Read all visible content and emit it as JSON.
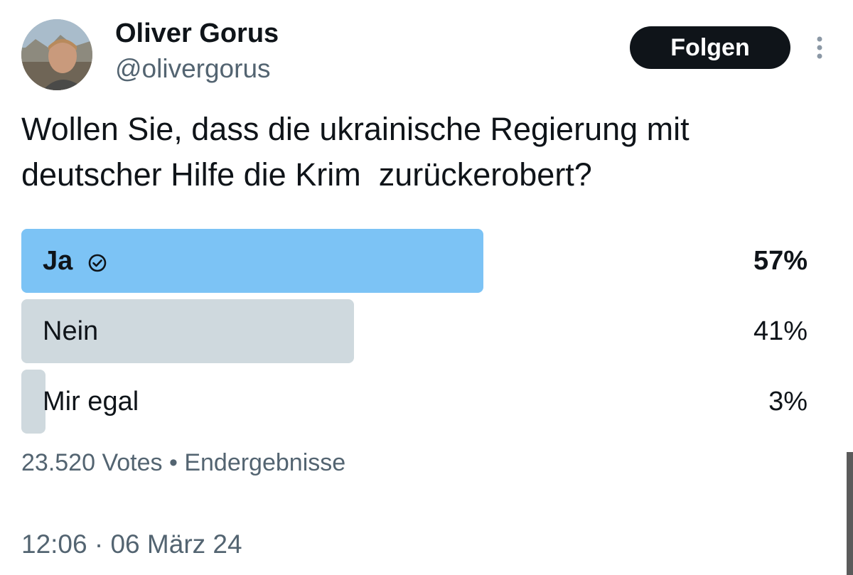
{
  "author": {
    "name": "Oliver Gorus",
    "handle": "@olivergorus"
  },
  "follow_label": "Folgen",
  "tweet_text": "Wollen Sie, dass die ukrainische Regierung mit\ndeutscher Hilfe die Krim  zurückerobert?",
  "poll": {
    "options": [
      {
        "label": "Ja",
        "percent_text": "57%",
        "percent": 57,
        "winner": true
      },
      {
        "label": "Nein",
        "percent_text": "41%",
        "percent": 41,
        "winner": false
      },
      {
        "label": "Mir egal",
        "percent_text": "3%",
        "percent": 3,
        "winner": false
      }
    ],
    "votes": "23.520 Votes",
    "status": "Endergebnisse",
    "separator": "•"
  },
  "time": "12:06",
  "date": "06 März 24",
  "time_separator": "·",
  "colors": {
    "winner_bar": "#7cc3f5",
    "loser_bar": "#cfd9de",
    "muted_text": "#536471",
    "primary_text": "#0f1419"
  },
  "icons": {
    "more": "more-vertical-icon",
    "winner_check": "check-circle-icon"
  }
}
